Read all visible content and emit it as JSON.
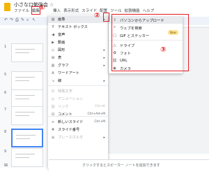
{
  "app": {
    "title": "小さな口勉強会",
    "menus": [
      "ファイル",
      "編集",
      "表示",
      "挿入",
      "表示形式",
      "スライド",
      "配置",
      "ツール",
      "拡張機能",
      "ヘルプ"
    ]
  },
  "annotations": {
    "step1": "①",
    "step2": "②",
    "step3": "③",
    "highlight_color": "#e81e25"
  },
  "slides": {
    "numbers": [
      "1",
      "5",
      "6",
      "7",
      "8",
      "9"
    ]
  },
  "insert_menu": {
    "items": [
      {
        "icon": "image-icon",
        "glyph": "▨",
        "label": "画像",
        "arrow": "▸",
        "active": true
      },
      {
        "icon": "textbox-icon",
        "glyph": "Ŧ",
        "label": "テキスト ボックス"
      },
      {
        "icon": "audio-icon",
        "glyph": "◀",
        "label": "音声"
      },
      {
        "icon": "video-icon",
        "glyph": "▶",
        "label": "動画"
      },
      {
        "icon": "shape-icon",
        "glyph": "◇",
        "label": "図形",
        "arrow": "▸"
      },
      {
        "icon": "table-icon",
        "glyph": "⊞",
        "label": "表",
        "arrow": "▸"
      },
      {
        "icon": "chart-icon",
        "glyph": "▥",
        "label": "グラフ",
        "arrow": "▸"
      },
      {
        "icon": "wordart-icon",
        "glyph": "A",
        "label": "ワードアート"
      },
      {
        "icon": "line-icon",
        "glyph": "↘",
        "label": "線",
        "arrow": "▸"
      },
      {
        "icon": "special-char-icon",
        "glyph": "Ω",
        "label": "特殊文字",
        "disabled": true
      },
      {
        "icon": "animation-icon",
        "glyph": "◎",
        "label": "アニメーション",
        "disabled": true
      },
      {
        "icon": "link-icon",
        "glyph": "⛓",
        "label": "リンク",
        "shortcut": "Ctrl+K",
        "disabled": true
      },
      {
        "icon": "comment-icon",
        "glyph": "⊡",
        "label": "コメント",
        "shortcut": "Ctrl+Alt+M"
      },
      {
        "icon": "new-slide-icon",
        "glyph": "+",
        "label": "新しいスライド",
        "shortcut": "Ctrl+M"
      },
      {
        "icon": "slide-number-icon",
        "glyph": "#",
        "label": "スライド番号"
      },
      {
        "icon": "placeholder-icon",
        "glyph": "▣",
        "label": "プレースホルダ",
        "arrow": "▸",
        "disabled": true
      }
    ]
  },
  "image_submenu": {
    "items": [
      {
        "icon": "upload-icon",
        "glyph": "⇪",
        "label": "パソコンからアップロード",
        "active": true
      },
      {
        "icon": "web-search-icon",
        "glyph": "⌕",
        "label": "ウェブを検索"
      },
      {
        "icon": "gif-sticker-icon",
        "glyph": "▢",
        "label": "GIF とステッカー",
        "badge": "New"
      },
      {
        "icon": "drive-icon",
        "glyph": "△",
        "label": "ドライブ"
      },
      {
        "icon": "photos-icon",
        "glyph": "✿",
        "label": "フォト"
      },
      {
        "icon": "url-icon",
        "glyph": "⛓",
        "label": "URL"
      },
      {
        "icon": "camera-icon",
        "glyph": "◉",
        "label": "カメラ"
      }
    ]
  },
  "notes": {
    "placeholder": "クリックするとスピーカー ノートを追加できます"
  }
}
